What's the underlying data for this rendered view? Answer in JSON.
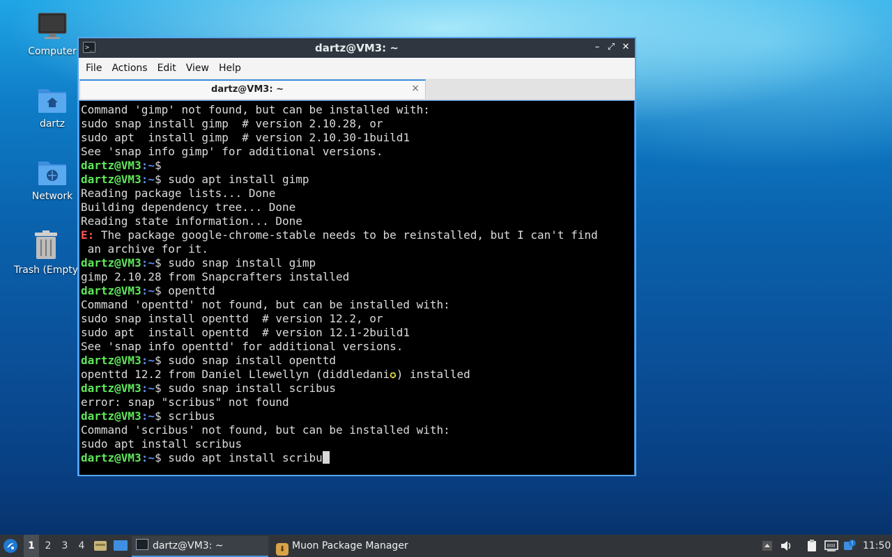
{
  "desktop": {
    "icons": [
      {
        "label": "Computer",
        "icon": "monitor-icon"
      },
      {
        "label": "dartz",
        "icon": "home-folder-icon"
      },
      {
        "label": "Network",
        "icon": "network-folder-icon"
      },
      {
        "label": "Trash (Empty)",
        "icon": "trash-icon"
      }
    ]
  },
  "window": {
    "title": "dartz@VM3: ~",
    "controls": {
      "minimize": "–",
      "maximize": "⤢",
      "close": "✕"
    },
    "menu": [
      "File",
      "Actions",
      "Edit",
      "View",
      "Help"
    ],
    "tab": {
      "label": "dartz@VM3: ~",
      "close": "×"
    }
  },
  "terminal": {
    "prompt_user": "dartz@VM3",
    "prompt_path": ":~",
    "prompt_symbol": "$",
    "lines": [
      {
        "type": "out",
        "text": "Command 'gimp' not found, but can be installed with:"
      },
      {
        "type": "out",
        "text": "sudo snap install gimp  # version 2.10.28, or"
      },
      {
        "type": "out",
        "text": "sudo apt  install gimp  # version 2.10.30-1build1"
      },
      {
        "type": "out",
        "text": "See 'snap info gimp' for additional versions."
      },
      {
        "type": "prompt",
        "text": ""
      },
      {
        "type": "prompt",
        "text": " sudo apt install gimp"
      },
      {
        "type": "out",
        "text": "Reading package lists... Done"
      },
      {
        "type": "out",
        "text": "Building dependency tree... Done"
      },
      {
        "type": "out",
        "text": "Reading state information... Done"
      },
      {
        "type": "err",
        "prefix": "E:",
        "text": " The package google-chrome-stable needs to be reinstalled, but I can't find"
      },
      {
        "type": "out",
        "text": " an archive for it."
      },
      {
        "type": "prompt",
        "text": " sudo snap install gimp"
      },
      {
        "type": "out",
        "text": "gimp 2.10.28 from Snapcrafters installed"
      },
      {
        "type": "prompt",
        "text": " openttd"
      },
      {
        "type": "out",
        "text": "Command 'openttd' not found, but can be installed with:"
      },
      {
        "type": "out",
        "text": "sudo snap install openttd  # version 12.2, or"
      },
      {
        "type": "out",
        "text": "sudo apt  install openttd  # version 12.1-2build1"
      },
      {
        "type": "out",
        "text": "See 'snap info openttd' for additional versions."
      },
      {
        "type": "prompt",
        "text": " sudo snap install openttd"
      },
      {
        "type": "star",
        "before": "openttd 12.2 from Daniel Llewellyn (diddledani",
        "star": "✪",
        "after": ") installed"
      },
      {
        "type": "prompt",
        "text": " sudo snap install scribus"
      },
      {
        "type": "out",
        "text": "error: snap \"scribus\" not found"
      },
      {
        "type": "prompt",
        "text": " scribus"
      },
      {
        "type": "out",
        "text": "Command 'scribus' not found, but can be installed with:"
      },
      {
        "type": "out",
        "text": "sudo apt install scribus"
      },
      {
        "type": "prompt_cursor",
        "text": " sudo apt install scribu"
      }
    ]
  },
  "taskbar": {
    "workspaces": [
      "1",
      "2",
      "3",
      "4"
    ],
    "active_workspace": "1",
    "tasks": [
      {
        "label": "dartz@VM3: ~",
        "icon": "terminal-icon",
        "active": true
      },
      {
        "label": "Muon Package Manager",
        "icon": "package-manager-icon",
        "active": false
      }
    ],
    "clock": "11:50"
  }
}
